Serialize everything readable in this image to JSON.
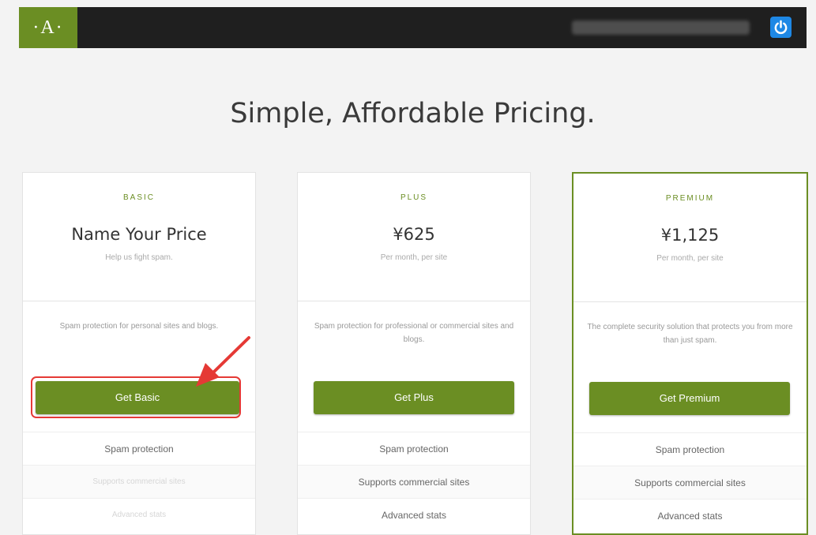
{
  "header": {
    "logo_text": "·A·",
    "power_icon": "power-icon"
  },
  "page": {
    "title": "Simple, Affordable Pricing."
  },
  "plans": [
    {
      "tier": "BASIC",
      "price": "Name Your Price",
      "note": "Help us fight spam.",
      "description": "Spam protection for personal sites and blogs.",
      "button_label": "Get Basic",
      "features": [
        {
          "label": "Spam protection",
          "enabled": true
        },
        {
          "label": "Supports commercial sites",
          "enabled": false
        },
        {
          "label": "Advanced stats",
          "enabled": false
        }
      ]
    },
    {
      "tier": "PLUS",
      "price": "¥625",
      "note": "Per month, per site",
      "description": "Spam protection for professional or commercial sites and blogs.",
      "button_label": "Get Plus",
      "features": [
        {
          "label": "Spam protection",
          "enabled": true
        },
        {
          "label": "Supports commercial sites",
          "enabled": true
        },
        {
          "label": "Advanced stats",
          "enabled": true
        }
      ]
    },
    {
      "tier": "PREMIUM",
      "price": "¥1,125",
      "note": "Per month, per site",
      "description": "The complete security solution that protects you from more than just spam.",
      "button_label": "Get Premium",
      "features": [
        {
          "label": "Spam protection",
          "enabled": true
        },
        {
          "label": "Supports commercial sites",
          "enabled": true
        },
        {
          "label": "Advanced stats",
          "enabled": true
        }
      ]
    }
  ],
  "colors": {
    "accent": "#6b8e23",
    "header_bg": "#1f1f1f",
    "power_button": "#1e88e5",
    "annotation": "#e53935"
  }
}
